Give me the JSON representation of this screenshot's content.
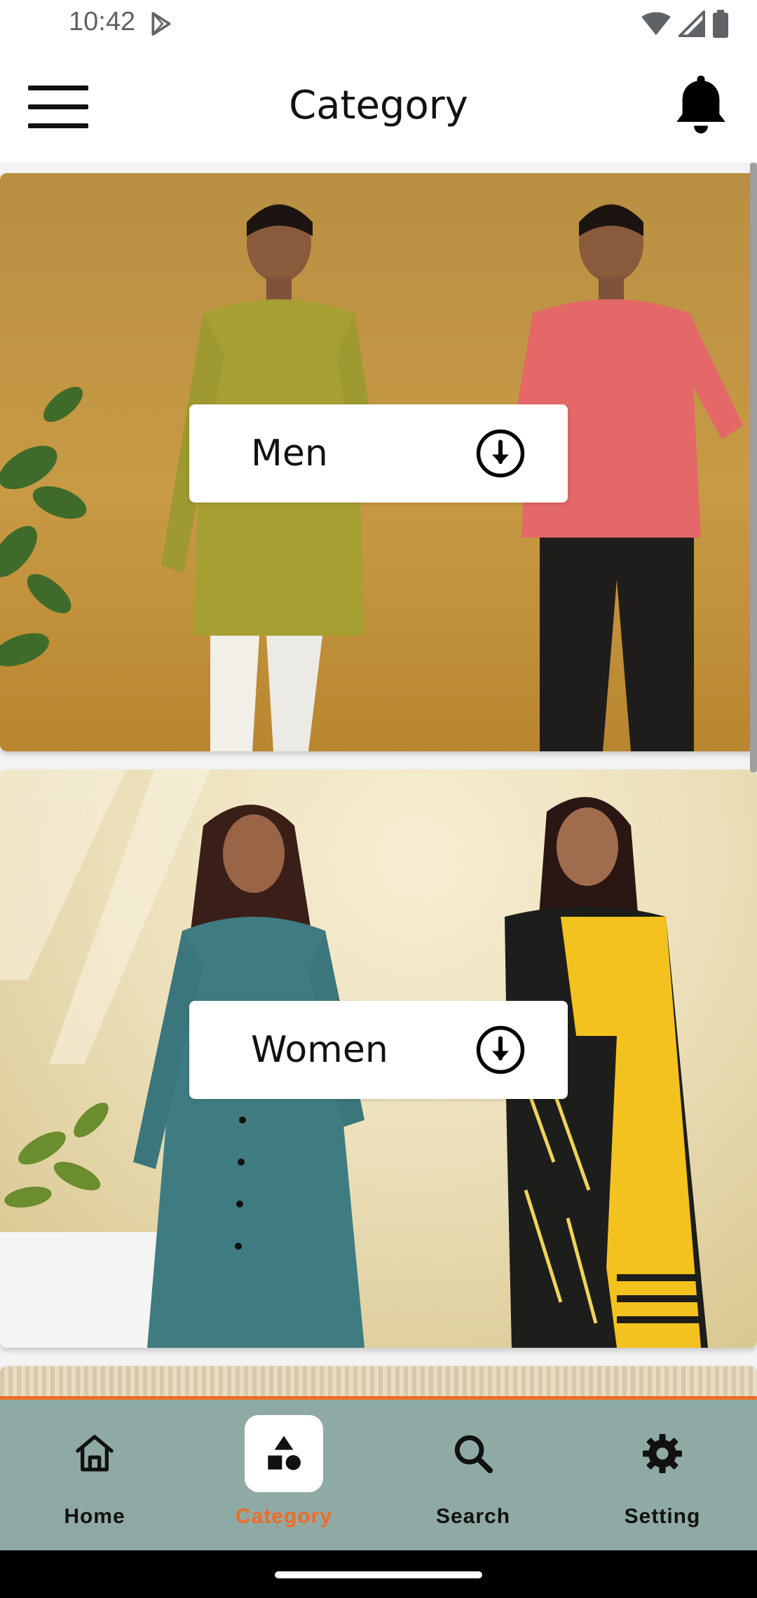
{
  "status_bar": {
    "time": "10:42"
  },
  "app_bar": {
    "title": "Category"
  },
  "categories": [
    {
      "label": "Men"
    },
    {
      "label": "Women"
    }
  ],
  "bottom_nav": {
    "items": [
      {
        "label": "Home",
        "icon": "home-icon"
      },
      {
        "label": "Category",
        "icon": "category-icon",
        "active": true
      },
      {
        "label": "Search",
        "icon": "search-icon"
      },
      {
        "label": "Setting",
        "icon": "gear-icon"
      }
    ]
  },
  "colors": {
    "accent": "#ef6c23",
    "nav_background": "#8faaa5"
  }
}
